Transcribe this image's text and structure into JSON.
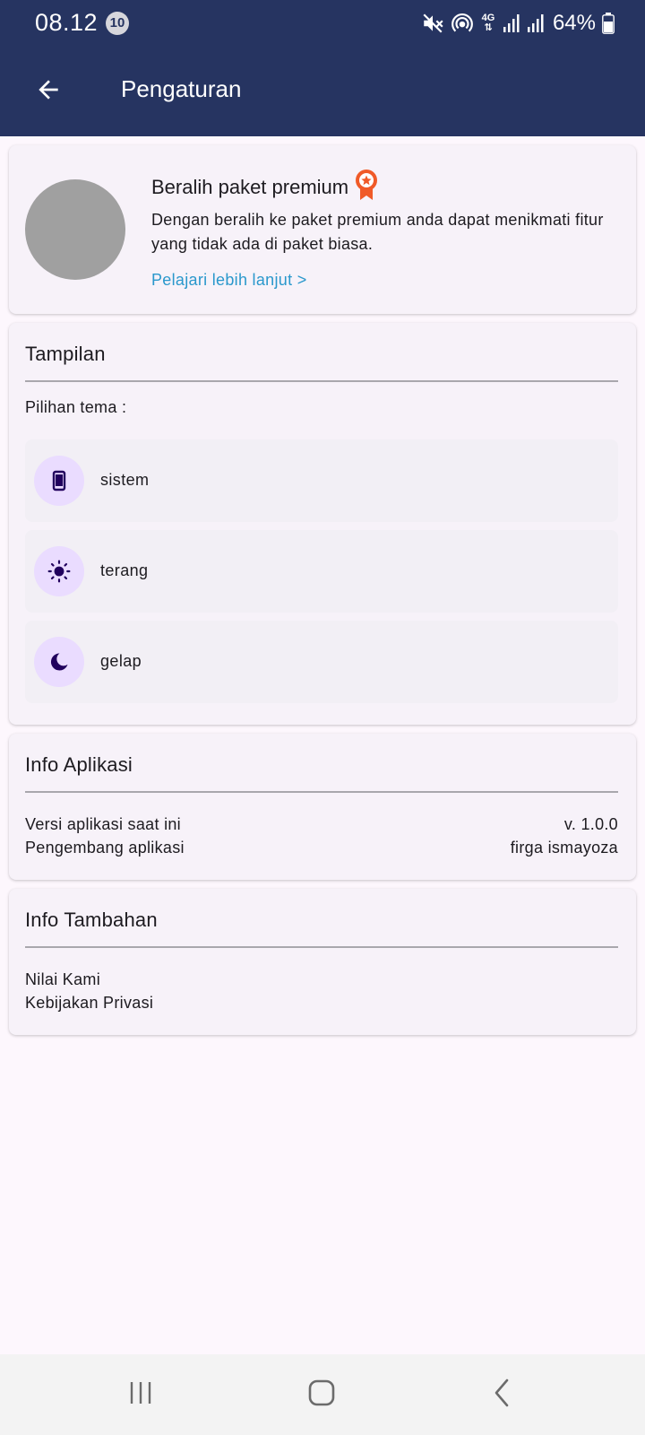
{
  "status_bar": {
    "time": "08.12",
    "notification_count": "10",
    "network_label": "4G",
    "battery": "64%"
  },
  "app_bar": {
    "title": "Pengaturan"
  },
  "premium": {
    "title": "Beralih paket premium",
    "description": "Dengan beralih ke paket premium anda dapat menikmati fitur yang tidak ada di paket biasa.",
    "link": "Pelajari lebih lanjut >"
  },
  "display": {
    "title": "Tampilan",
    "theme_label": "Pilihan tema :",
    "options": [
      {
        "label": "sistem",
        "icon": "smartphone-icon"
      },
      {
        "label": "terang",
        "icon": "sun-icon"
      },
      {
        "label": "gelap",
        "icon": "moon-icon"
      }
    ]
  },
  "app_info": {
    "title": "Info Aplikasi",
    "rows": [
      {
        "label": "Versi aplikasi saat ini",
        "value": "v. 1.0.0"
      },
      {
        "label": "Pengembang aplikasi",
        "value": "firga ismayoza"
      }
    ]
  },
  "extra_info": {
    "title": "Info Tambahan",
    "items": [
      "Nilai Kami",
      "Kebijakan Privasi"
    ]
  },
  "colors": {
    "header": "#263461",
    "link": "#2a98cc",
    "premium_badge": "#f05a28",
    "theme_icon_bg": "#eadcff",
    "theme_icon_fg": "#21005d"
  }
}
